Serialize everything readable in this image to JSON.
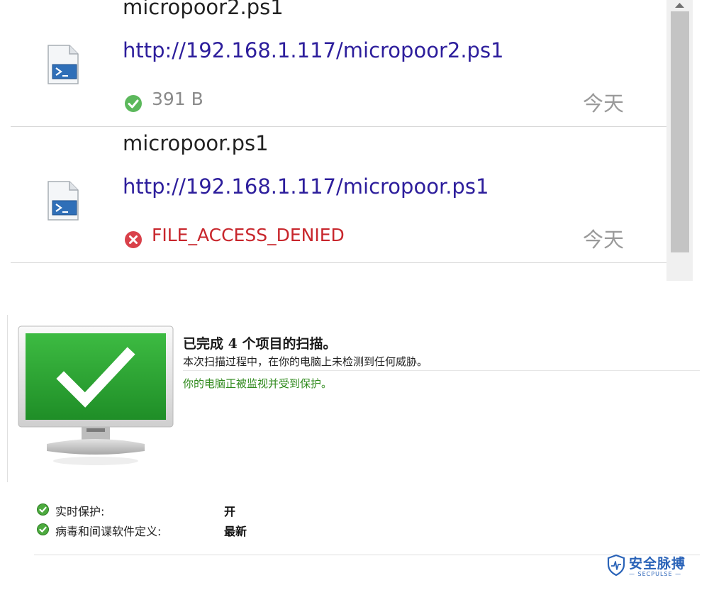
{
  "downloads": [
    {
      "filename": "micropoor2.ps1",
      "url": "http://192.168.1.117/micropoor2.ps1",
      "status_icon": "check-circle-icon",
      "status_text": "391 B",
      "status_color": "#5cb85c",
      "date": "今天"
    },
    {
      "filename": "micropoor.ps1",
      "url": "http://192.168.1.117/micropoor.ps1",
      "status_icon": "error-circle-icon",
      "status_text": "FILE_ACCESS_DENIED",
      "status_color": "#d9414a",
      "date": "今天"
    }
  ],
  "partial_next_item": "· ·",
  "scan": {
    "title": "已完成 4 个项目的扫描。",
    "subtitle": "本次扫描过程中，在你的电脑上未检测到任何威胁。",
    "protected_text": "你的电脑正被监视并受到保护。",
    "status_rows": [
      {
        "label": "实时保护:",
        "value": "开"
      },
      {
        "label": "病毒和间谍软件定义:",
        "value": "最新"
      }
    ]
  },
  "watermark": {
    "text": "安全脉搏",
    "subtext": "— SECPULSE —"
  },
  "colors": {
    "link": "#2d1e9c",
    "error": "#c8262c",
    "ok_green": "#5cb85c",
    "monitor_green": "#2fa533",
    "protected_green": "#2f8a1c",
    "watermark_blue": "#2a63b8"
  }
}
